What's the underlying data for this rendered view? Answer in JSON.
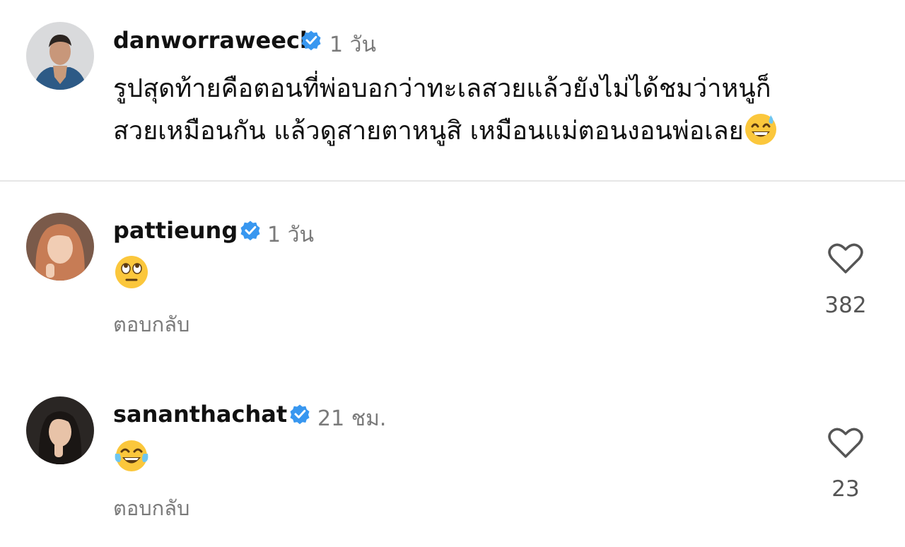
{
  "post": {
    "username": "danworraweech",
    "time": "1 วัน",
    "caption_line1": "รูปสุดท้ายคือตอนที่พ่อบอกว่าทะเลสวยแล้วยังไม่ได้ชมว่าหนูก็",
    "caption_line2": "สวยเหมือนกัน แล้วดูสายตาหนูสิ เหมือนแม่ตอนงอนพ่อเลย",
    "caption_emoji": "sweat-smile-emoji"
  },
  "comments": [
    {
      "username": "pattieung",
      "time": "1 วัน",
      "emoji": "eye-roll-emoji",
      "reply_label": "ตอบกลับ",
      "likes": "382"
    },
    {
      "username": "sananthachat",
      "time": "21 ชม.",
      "emoji": "tears-of-joy-emoji",
      "reply_label": "ตอบกลับ",
      "likes": "23"
    }
  ],
  "colors": {
    "verified": "#3897f0",
    "muted": "#7a7a7a",
    "emoji_yellow": "#fbc73c"
  }
}
